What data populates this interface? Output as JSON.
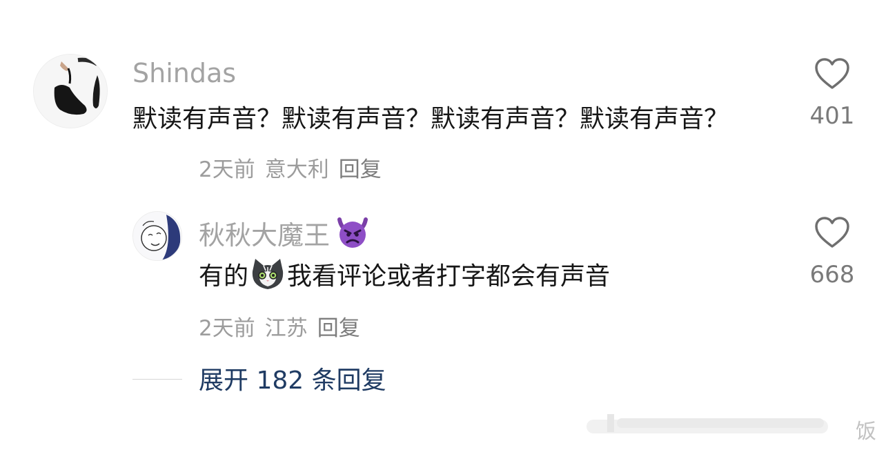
{
  "comments": [
    {
      "username": "Shindas",
      "text": "默读有声音？默读有声音？默读有声音？默读有声音？",
      "time": "2天前",
      "location": "意大利",
      "reply_label": "回复",
      "likes": "401"
    },
    {
      "username": "秋秋大魔王",
      "username_emoji": "devil-emoji-icon",
      "text_before": "有的",
      "text_emoji": "cat-emoji-icon",
      "text_after": "我看评论或者打字都会有声音",
      "time": "2天前",
      "location": "江苏",
      "reply_label": "回复",
      "likes": "668"
    }
  ],
  "expand": {
    "label": "展开 182 条回复"
  },
  "watermark": {
    "text": "饭"
  },
  "colors": {
    "username": "#a3a3a3",
    "content": "#161616",
    "meta": "#9c9c9c",
    "expand_link": "#1f3b63",
    "heart": "#6f6f6f"
  }
}
